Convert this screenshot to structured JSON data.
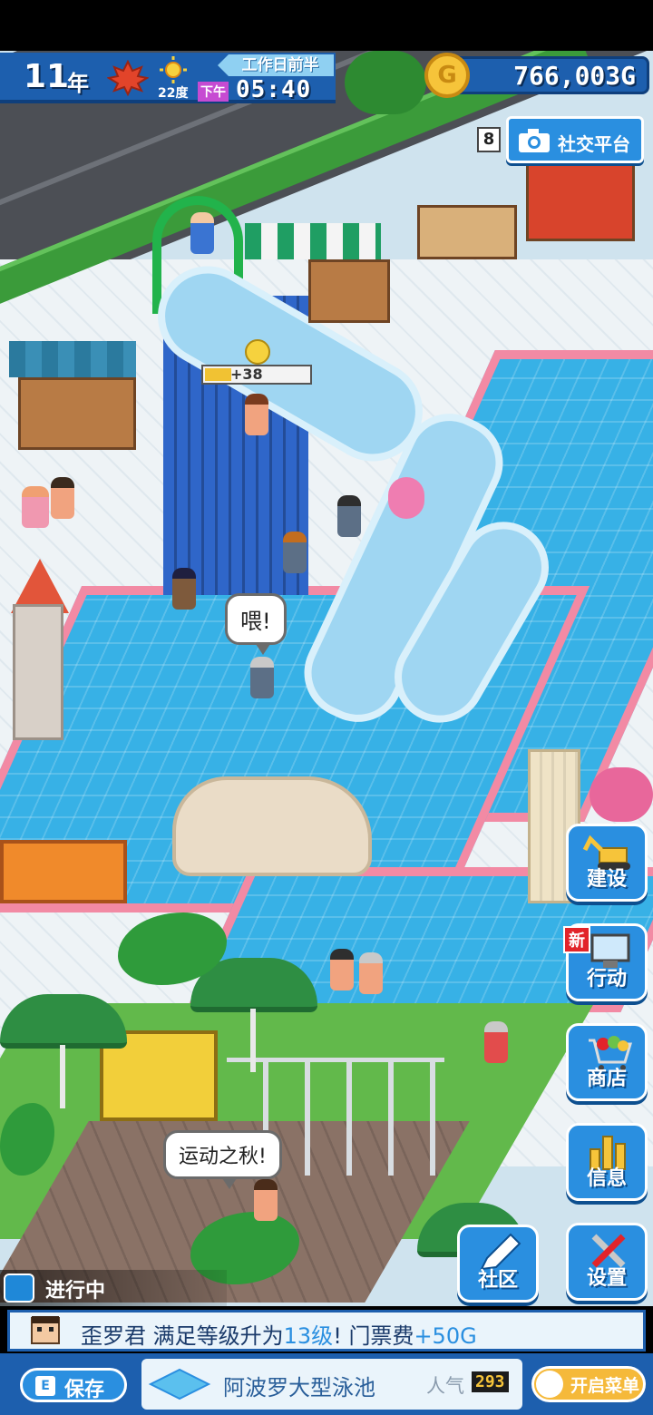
{
  "hud": {
    "year_number": "11",
    "year_unit": "年",
    "season_icon": "maple-leaf",
    "weather_icon": "sun",
    "temperature": "22度",
    "day_period": "工作日前半",
    "ampm": "下午",
    "time": "05:40"
  },
  "gold": {
    "amount": "766,003G",
    "coin_letter": "G"
  },
  "camera": {
    "count": "8",
    "social_label": "社交平台"
  },
  "scene": {
    "gauge_value": "+38",
    "gauge_fill_fraction": 0.25,
    "speech_hey": "喂!",
    "speech_autumn": "运动之秋!"
  },
  "side_menu": [
    {
      "label": "建设",
      "icon": "excavator-icon",
      "badge": ""
    },
    {
      "label": "行动",
      "icon": "computer-icon",
      "badge": "新"
    },
    {
      "label": "商店",
      "icon": "shopping-cart-icon",
      "badge": ""
    },
    {
      "label": "信息",
      "icon": "bar-chart-icon",
      "badge": ""
    },
    {
      "label": "设置",
      "icon": "tools-icon",
      "badge": ""
    }
  ],
  "community": {
    "label": "社区",
    "icon": "pencil-icon"
  },
  "status": {
    "label": "进行中",
    "icon": "bulb-icon"
  },
  "news": {
    "name": "歪罗君",
    "text1": " 满足等级升为",
    "level": "13级",
    "text2": "! 门票费",
    "fee": "+50G"
  },
  "bottom": {
    "save_label": "保存",
    "park_name": "阿波罗大型泳池",
    "popularity_label": "人气",
    "popularity_value": "293",
    "menu_label": "开启菜单"
  },
  "colors": {
    "hud_blue": "#1d5fae",
    "button_blue": "#2a8fe0",
    "pool": "#37b1e6",
    "pool_edge": "#f28aa4",
    "gold": "#f6c43a"
  }
}
